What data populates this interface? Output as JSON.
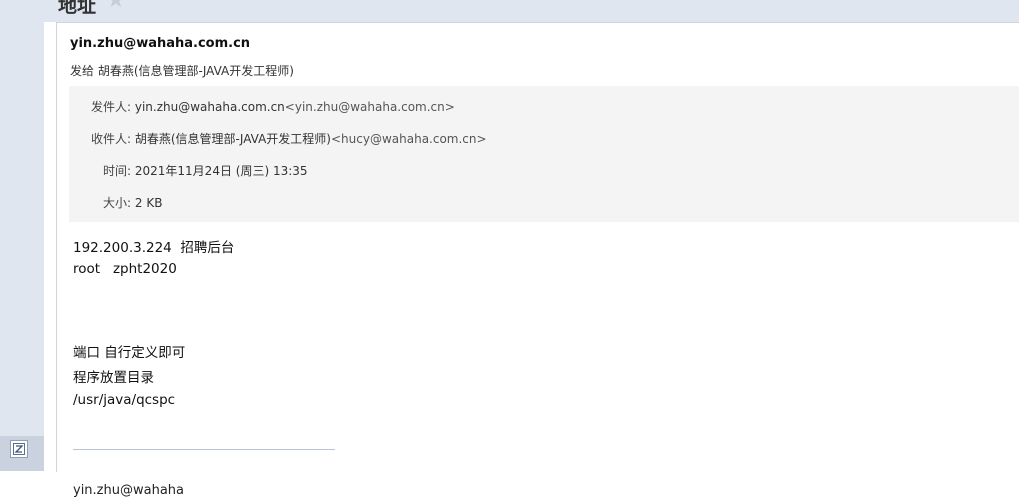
{
  "email": {
    "subject": "地址",
    "sender_address": "yin.zhu@wahaha.com.cn",
    "sent_to": "发给 胡春燕(信息管理部-JAVA开发工程师)",
    "meta": {
      "from_label": "发件人:",
      "from_name": "yin.zhu@wahaha.com.cn",
      "from_email": "<yin.zhu@wahaha.com.cn>",
      "to_label": "收件人:",
      "to_name": "胡春燕(信息管理部-JAVA开发工程师)",
      "to_email": "<hucy@wahaha.com.cn>",
      "time_label": "时间:",
      "time_value": "2021年11月24日 (周三) 13:35",
      "size_label": "大小:",
      "size_value": "2 KB"
    },
    "body_lines": [
      "192.200.3.224  招聘后台",
      "root   zpht2020",
      "端口 自行定义即可",
      "程序放置目录",
      "/usr/java/qcspc"
    ],
    "signature_partial": "yin.zhu@wahaha"
  },
  "icons": {
    "star": "star-icon",
    "compose": "compose-icon"
  },
  "colors": {
    "sidebar_bg": "#dfe6ef",
    "meta_bg": "#f4f4f4",
    "divider": "#b9c4d2"
  }
}
